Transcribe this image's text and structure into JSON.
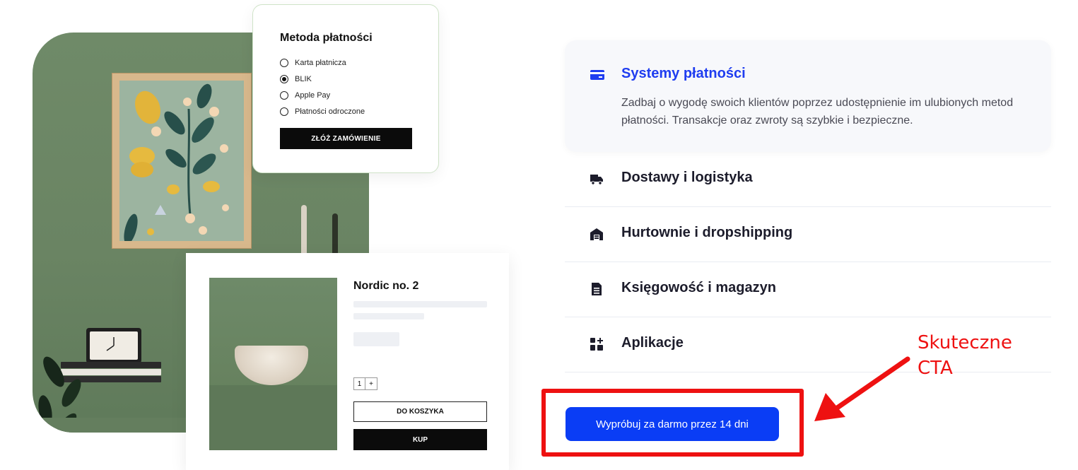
{
  "payment_card": {
    "title": "Metoda płatności",
    "options": [
      {
        "label": "Karta płatnicza",
        "checked": false
      },
      {
        "label": "BLIK",
        "checked": true
      },
      {
        "label": "Apple Pay",
        "checked": false
      },
      {
        "label": "Płatności odroczone",
        "checked": false
      }
    ],
    "order_button": "ZŁÓŻ ZAMÓWIENIE"
  },
  "product_card": {
    "title": "Nordic no. 2",
    "quantity": "1",
    "plus": "+",
    "cart_button": "DO KOSZYKA",
    "buy_button": "KUP"
  },
  "accordion": {
    "active": {
      "title": "Systemy płatności",
      "description": "Zadbaj o wygodę swoich klientów poprzez udostępnienie im ulubionych metod płatności. Transakcje oraz zwroty są szybkie i bezpieczne.",
      "icon": "credit-card-icon"
    },
    "items": [
      {
        "label": "Dostawy i logistyka",
        "icon": "truck-icon"
      },
      {
        "label": "Hurtownie i dropshipping",
        "icon": "warehouse-icon"
      },
      {
        "label": "Księgowość i magazyn",
        "icon": "document-icon"
      },
      {
        "label": "Aplikacje",
        "icon": "apps-icon"
      }
    ]
  },
  "cta": {
    "label": "Wypróbuj za darmo przez 14 dni"
  },
  "annotation": {
    "text": "Skuteczne CTA",
    "color": "#ee1111"
  },
  "colors": {
    "accent": "#0a3df5",
    "active_title": "#1f3df0",
    "annotation": "#ee1111"
  }
}
